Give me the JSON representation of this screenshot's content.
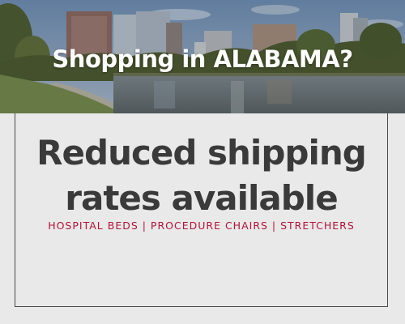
{
  "headline": "Shopping in ALABAMA?",
  "main_line_1": "Reduced shipping",
  "main_line_2": "rates available",
  "products_line": "HOSPITAL BEDS | PROCEDURE CHAIRS | STRETCHERS",
  "colors": {
    "background": "#e9e9e9",
    "main_text": "#3a3a3a",
    "accent": "#b5123a",
    "border": "#4a4a4a"
  }
}
